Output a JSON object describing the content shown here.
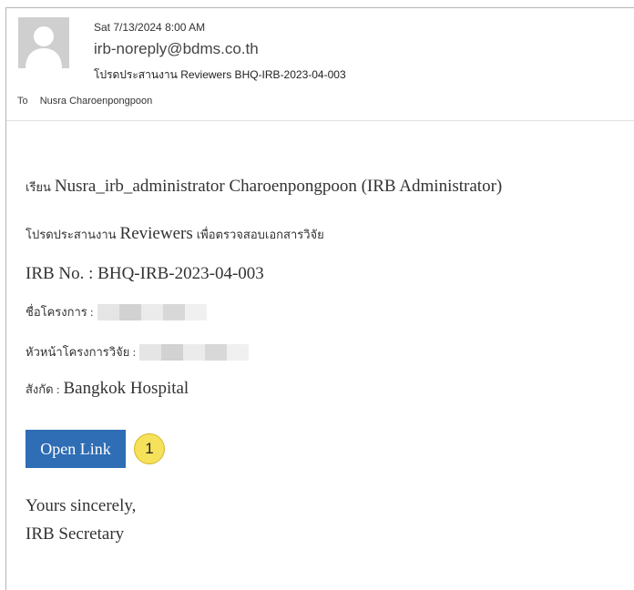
{
  "email": {
    "date": "Sat 7/13/2024 8:00 AM",
    "from": "irb-noreply@bdms.co.th",
    "subject": "โปรดประสานงาน Reviewers BHQ-IRB-2023-04-003",
    "to_label": "To",
    "to_name": "Nusra Charoenpongpoon"
  },
  "body": {
    "greeting_prefix": "เรียน",
    "greeting_name": "Nusra_irb_administrator Charoenpongpoon (IRB Administrator)",
    "request_prefix": "โปรดประสานงาน",
    "request_mid": "Reviewers",
    "request_suffix": "เพื่อตรวจสอบเอกสารวิจัย",
    "irb_no": "IRB No. : BHQ-IRB-2023-04-003",
    "project_label": "ชื่อโครงการ :",
    "pi_label": "หัวหน้าโครงการวิจัย :",
    "affiliation_label": "สังกัด :",
    "affiliation_value": "Bangkok Hospital",
    "open_link_label": "Open Link",
    "callout_number": "1",
    "closing_1": "Yours sincerely,",
    "closing_2": "IRB Secretary"
  }
}
